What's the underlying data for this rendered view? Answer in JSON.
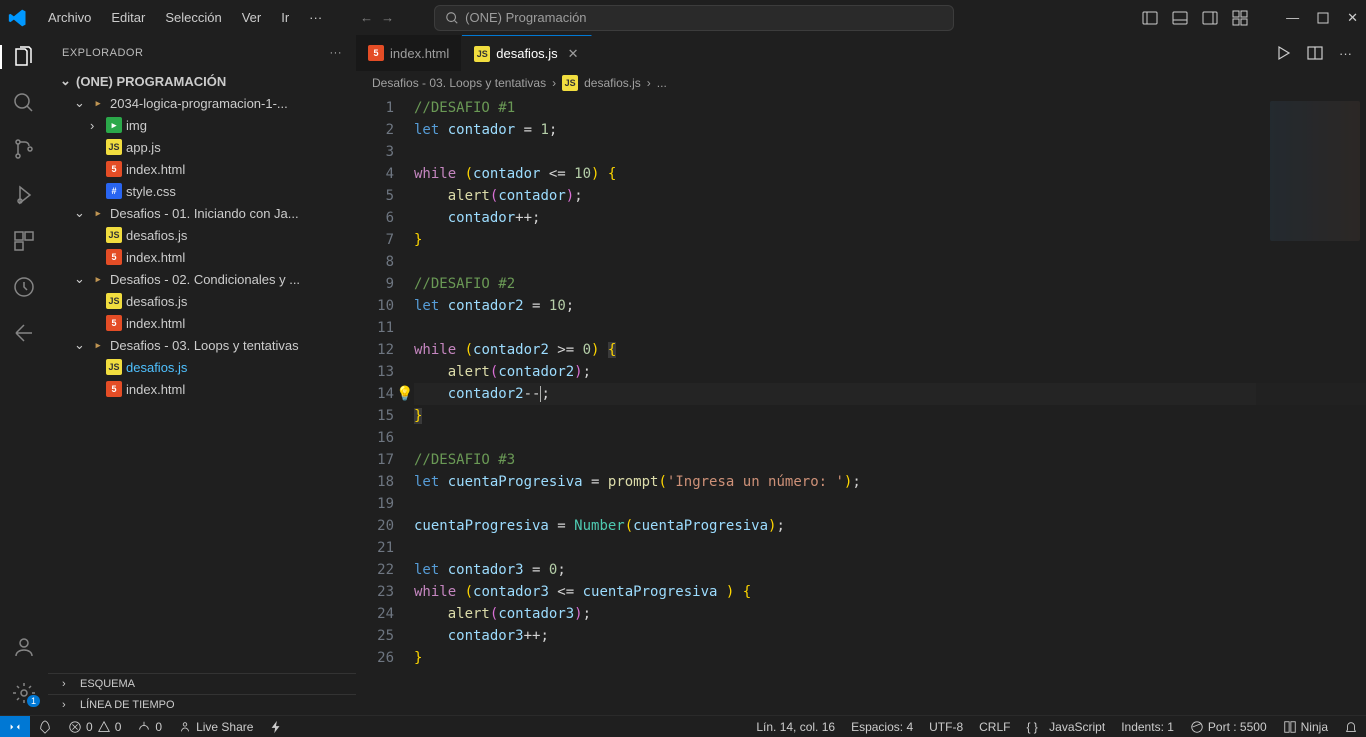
{
  "titlebar": {
    "menu": [
      "Archivo",
      "Editar",
      "Selección",
      "Ver",
      "Ir",
      "···"
    ],
    "search_placeholder": "(ONE) Programación"
  },
  "activitybar": {
    "badge": "1"
  },
  "sidebar": {
    "title": "EXPLORADOR",
    "root": "(ONE) PROGRAMACIÓN",
    "folder1": "2034-logica-programacion-1-...",
    "img_folder": "img",
    "appjs": "app.js",
    "indexhtml": "index.html",
    "stylecss": "style.css",
    "desafios1": "Desafios - 01. Iniciando con Ja...",
    "desafiosjs": "desafios.js",
    "desafios2": "Desafios - 02. Condicionales y ...",
    "desafios3": "Desafios - 03. Loops y tentativas",
    "outline": "ESQUEMA",
    "timeline": "LÍNEA DE TIEMPO"
  },
  "tabs": {
    "inactive": "index.html",
    "active": "desafios.js"
  },
  "breadcrumb": {
    "p1": "Desafios - 03. Loops y tentativas",
    "p2": "desafios.js",
    "p3": "..."
  },
  "code": {
    "l1_comment": "//DESAFIO #1",
    "l2_let": "let",
    "l2_var": "contador",
    "l2_eq": " = ",
    "l2_val": "1",
    "l2_semi": ";",
    "l4_while": "while",
    "l4_a": " (",
    "l4_var": "contador",
    "l4_op": " <= ",
    "l4_n": "10",
    "l4_b": ") ",
    "l4_brace": "{",
    "l5_sp": "    ",
    "l5_fn": "alert",
    "l5_a": "(",
    "l5_var": "contador",
    "l5_b": ")",
    "l5_semi": ";",
    "l6_sp": "    ",
    "l6_var": "contador",
    "l6_op": "++",
    "l6_semi": ";",
    "l7_brace": "}",
    "l9_comment": "//DESAFIO #2",
    "l10_let": "let",
    "l10_var": "contador2",
    "l10_eq": " = ",
    "l10_val": "10",
    "l10_semi": ";",
    "l12_while": "while",
    "l12_a": " (",
    "l12_var": "contador2",
    "l12_op": " >= ",
    "l12_n": "0",
    "l12_b": ") ",
    "l12_brace": "{",
    "l13_sp": "    ",
    "l13_fn": "alert",
    "l13_a": "(",
    "l13_var": "contador2",
    "l13_b": ")",
    "l13_semi": ";",
    "l14_sp": "    ",
    "l14_var": "contador2",
    "l14_op": "--",
    "l14_semi": ";",
    "l15_brace": "}",
    "l17_comment": "//DESAFIO #3",
    "l18_let": "let",
    "l18_var": "cuentaProgresiva",
    "l18_eq": " = ",
    "l18_fn": "prompt",
    "l18_a": "(",
    "l18_str": "'Ingresa un número: '",
    "l18_b": ")",
    "l18_semi": ";",
    "l20_var": "cuentaProgresiva",
    "l20_eq": " = ",
    "l20_cls": "Number",
    "l20_a": "(",
    "l20_var2": "cuentaProgresiva",
    "l20_b": ")",
    "l20_semi": ";",
    "l22_let": "let",
    "l22_var": "contador3",
    "l22_eq": " = ",
    "l22_val": "0",
    "l22_semi": ";",
    "l23_while": "while",
    "l23_a": " (",
    "l23_var": "contador3",
    "l23_op": " <= ",
    "l23_var2": "cuentaProgresiva",
    "l23_b": " ) ",
    "l23_brace": "{",
    "l24_sp": "    ",
    "l24_fn": "alert",
    "l24_a": "(",
    "l24_var": "contador3",
    "l24_b": ")",
    "l24_semi": ";",
    "l25_sp": "    ",
    "l25_var": "contador3",
    "l25_op": "++",
    "l25_semi": ";",
    "l26_brace": "}"
  },
  "linenumbers": [
    "1",
    "2",
    "3",
    "4",
    "5",
    "6",
    "7",
    "8",
    "9",
    "10",
    "11",
    "12",
    "13",
    "14",
    "15",
    "16",
    "17",
    "18",
    "19",
    "20",
    "21",
    "22",
    "23",
    "24",
    "25",
    "26"
  ],
  "statusbar": {
    "errors": "0",
    "warnings": "0",
    "ports": "0",
    "liveshare": "Live Share",
    "position": "Lín. 14, col. 16",
    "spaces": "Espacios: 4",
    "encoding": "UTF-8",
    "eol": "CRLF",
    "lang": "JavaScript",
    "indents": "Indents: 1",
    "port": "Port : 5500",
    "ninja": "Ninja"
  }
}
